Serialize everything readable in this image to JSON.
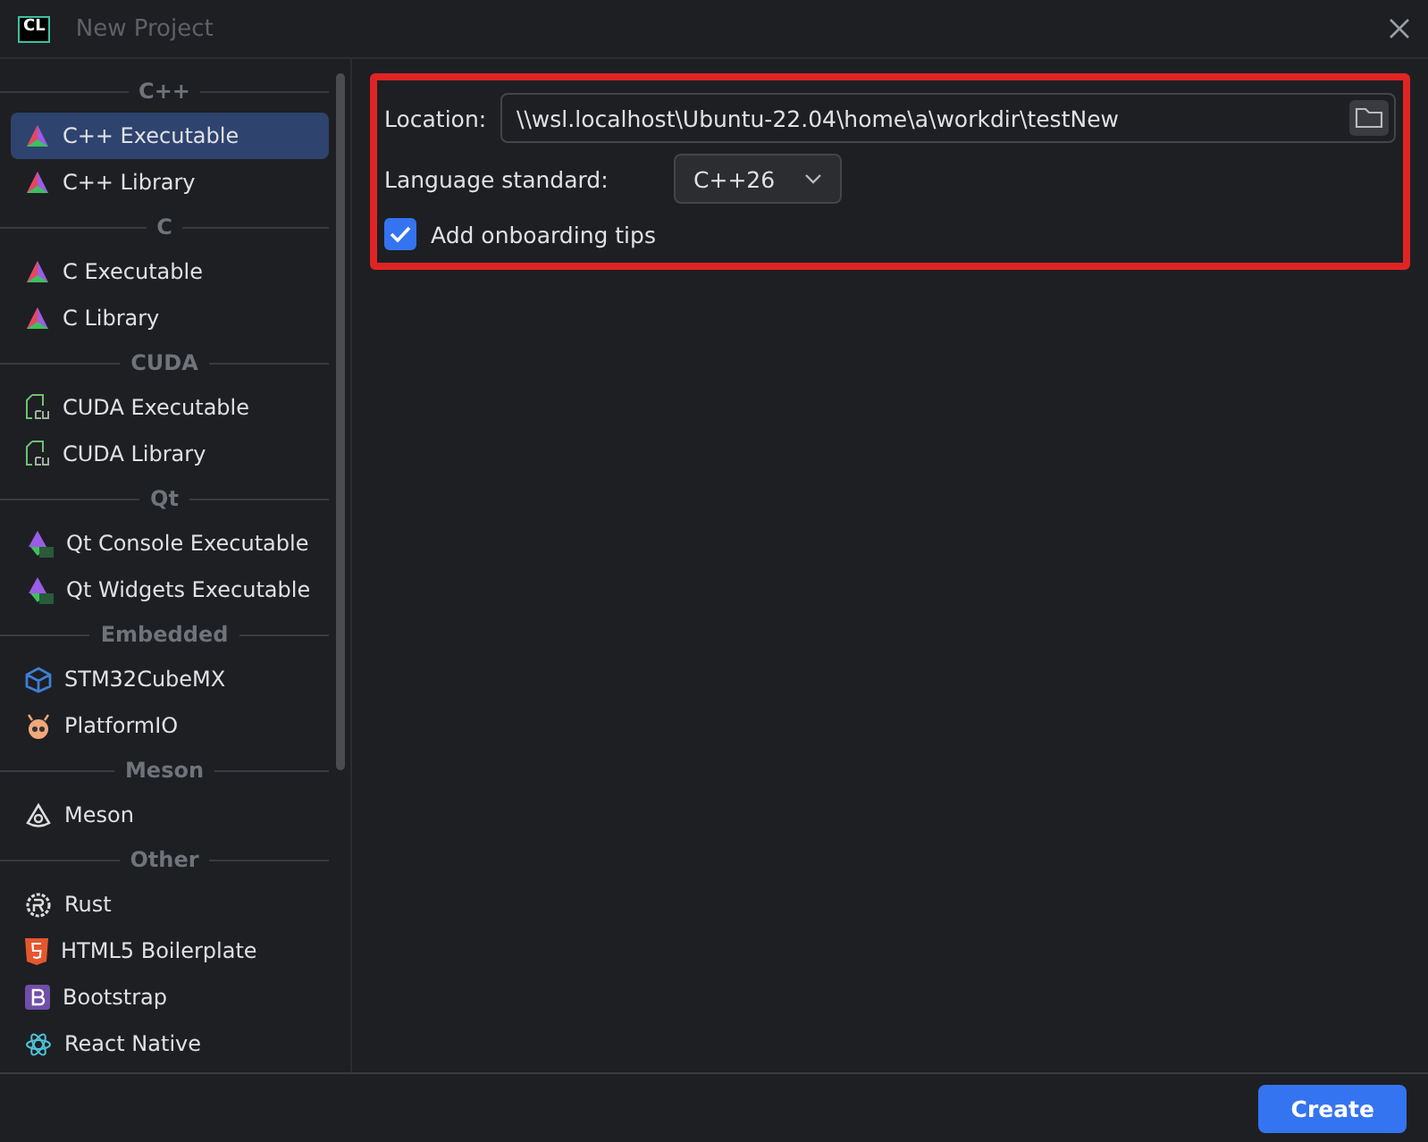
{
  "window": {
    "title": "New Project",
    "logo": "CL"
  },
  "sidebar": {
    "groups": [
      {
        "header": "C++",
        "items": [
          {
            "label": "C++ Executable",
            "kind": "cmake",
            "selected": true
          },
          {
            "label": "C++ Library",
            "kind": "cmake",
            "selected": false
          }
        ]
      },
      {
        "header": "C",
        "items": [
          {
            "label": "C Executable",
            "kind": "cmake",
            "selected": false
          },
          {
            "label": "C Library",
            "kind": "cmake",
            "selected": false
          }
        ]
      },
      {
        "header": "CUDA",
        "items": [
          {
            "label": "CUDA Executable",
            "kind": "cuda",
            "selected": false
          },
          {
            "label": "CUDA Library",
            "kind": "cuda",
            "selected": false
          }
        ]
      },
      {
        "header": "Qt",
        "items": [
          {
            "label": "Qt Console Executable",
            "kind": "qt",
            "selected": false
          },
          {
            "label": "Qt Widgets Executable",
            "kind": "qt",
            "selected": false
          }
        ]
      },
      {
        "header": "Embedded",
        "items": [
          {
            "label": "STM32CubeMX",
            "kind": "cube",
            "selected": false
          },
          {
            "label": "PlatformIO",
            "kind": "platformio",
            "selected": false
          }
        ]
      },
      {
        "header": "Meson",
        "items": [
          {
            "label": "Meson",
            "kind": "meson",
            "selected": false
          }
        ]
      },
      {
        "header": "Other",
        "items": [
          {
            "label": "Rust",
            "kind": "rust",
            "selected": false
          },
          {
            "label": "HTML5 Boilerplate",
            "kind": "html5",
            "selected": false
          },
          {
            "label": "Bootstrap",
            "kind": "bootstrap",
            "selected": false
          },
          {
            "label": "React Native",
            "kind": "react",
            "selected": false
          }
        ]
      }
    ]
  },
  "form": {
    "location_label": "Location:",
    "location": "\\\\wsl.localhost\\Ubuntu-22.04\\home\\a\\workdir\\testNew",
    "standard_label": "Language standard:",
    "standard": "C++26",
    "tips": {
      "label": "Add onboarding tips",
      "checked": true
    }
  },
  "buttons": {
    "create": "Create"
  }
}
